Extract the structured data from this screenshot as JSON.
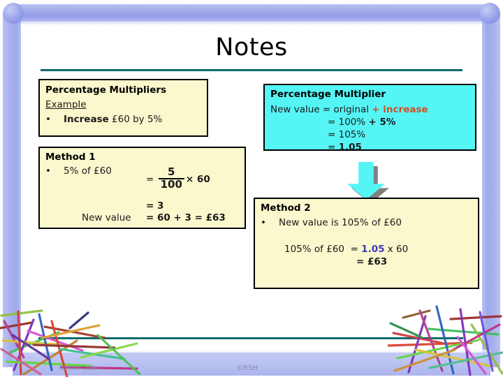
{
  "slide": {
    "title": "Notes",
    "accent_teal": "#0d6b6b",
    "frame_blue": "#9aa4ea",
    "box_yellow": "#fbf8cd",
    "box_cyan": "#55f5f5",
    "highlight_orange": "#cf4f23",
    "highlight_blue": "#3b3bbd"
  },
  "box_multipliers": {
    "title": "Percentage Multipliers",
    "example_label": "Example",
    "bullet": "•",
    "bullet_bold": "Increase",
    "bullet_rest": " £60 by 5%"
  },
  "box_method1": {
    "title": "Method 1",
    "bullet": "•",
    "line1_label": "5% of £60",
    "eq_sign": "=",
    "fraction_numerator": "5",
    "fraction_denominator": "100",
    "times_term": "× 60",
    "line2": "= 3",
    "new_value_label": "New value",
    "line3": "= 60 + 3 = £63"
  },
  "box_multiplier_cyan": {
    "title": "Percentage Multiplier",
    "row1_label": "New value",
    "row1_eq": "=",
    "row1_value": "original ",
    "row1_highlight": "+ increase",
    "row2_eq": "=",
    "row2_value": "100% ",
    "row2_highlight": "+ 5%",
    "row3_eq": "=",
    "row3_value": "105%",
    "row4_eq": "=",
    "row4_value": "1.05"
  },
  "arrow": {
    "name": "down-arrow"
  },
  "box_method2": {
    "title": "Method 2",
    "bullet": "•",
    "line1": "New value is 105% of £60",
    "line2_label": "105% of £60",
    "line2_eq": "=",
    "line2_highlight": "1.05",
    "line2_rest": " x 60",
    "line3": "= £63"
  },
  "footer": {
    "date": "October 2006",
    "copyright": "©RSH"
  }
}
